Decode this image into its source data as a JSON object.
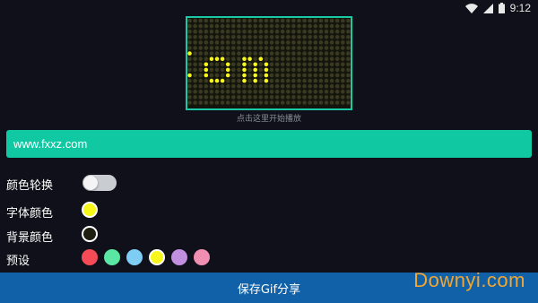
{
  "status_bar": {
    "time": "9:12"
  },
  "led": {
    "display_text": ":om",
    "dot_color": "#f7f71c",
    "off_dot_color": "#3a3a22",
    "hint": "点击这里开始播放"
  },
  "text_input": {
    "value": "www.fxxz.com"
  },
  "settings": {
    "color_cycle_label": "颜色轮换",
    "color_cycle_on": false,
    "font_color_label": "字体颜色",
    "font_color": "#f7f71c",
    "bg_color_label": "背景颜色",
    "bg_color": "#1d1e10",
    "preset_label": "预设",
    "presets": [
      {
        "color": "#f44b57",
        "selected": false
      },
      {
        "color": "#5ae6a3",
        "selected": false
      },
      {
        "color": "#7fcdf5",
        "selected": false
      },
      {
        "color": "#f7f71c",
        "selected": true
      },
      {
        "color": "#c18fe0",
        "selected": false
      },
      {
        "color": "#f08fb2",
        "selected": false
      }
    ]
  },
  "save_button": {
    "label": "保存Gif分享"
  },
  "watermark": {
    "text": "Downyi.com"
  }
}
